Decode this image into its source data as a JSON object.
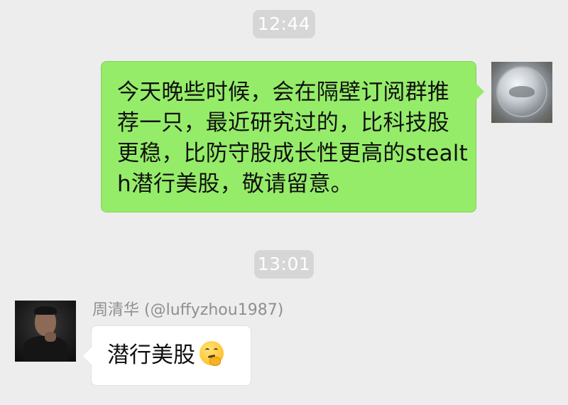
{
  "chat": {
    "timestamp_1": "12:44",
    "timestamp_2": "13:01",
    "outgoing_message": {
      "text": "今天晚些时候，会在隔壁订阅群推荐一只，最近研究过的，比科技股更稳，比防守股成长性更高的stealth潜行美股，敬请留意。"
    },
    "incoming_message": {
      "sender": "周清华 (@luffyzhou1987)",
      "text": "潜行美股",
      "emoji": "thinking-face-emoji"
    },
    "colors": {
      "background": "#ededed",
      "outgoing_bubble": "#95ec69",
      "incoming_bubble": "#ffffff",
      "timestamp_bg": "#d6d6d6",
      "sender_name": "#8f8f8f"
    }
  }
}
